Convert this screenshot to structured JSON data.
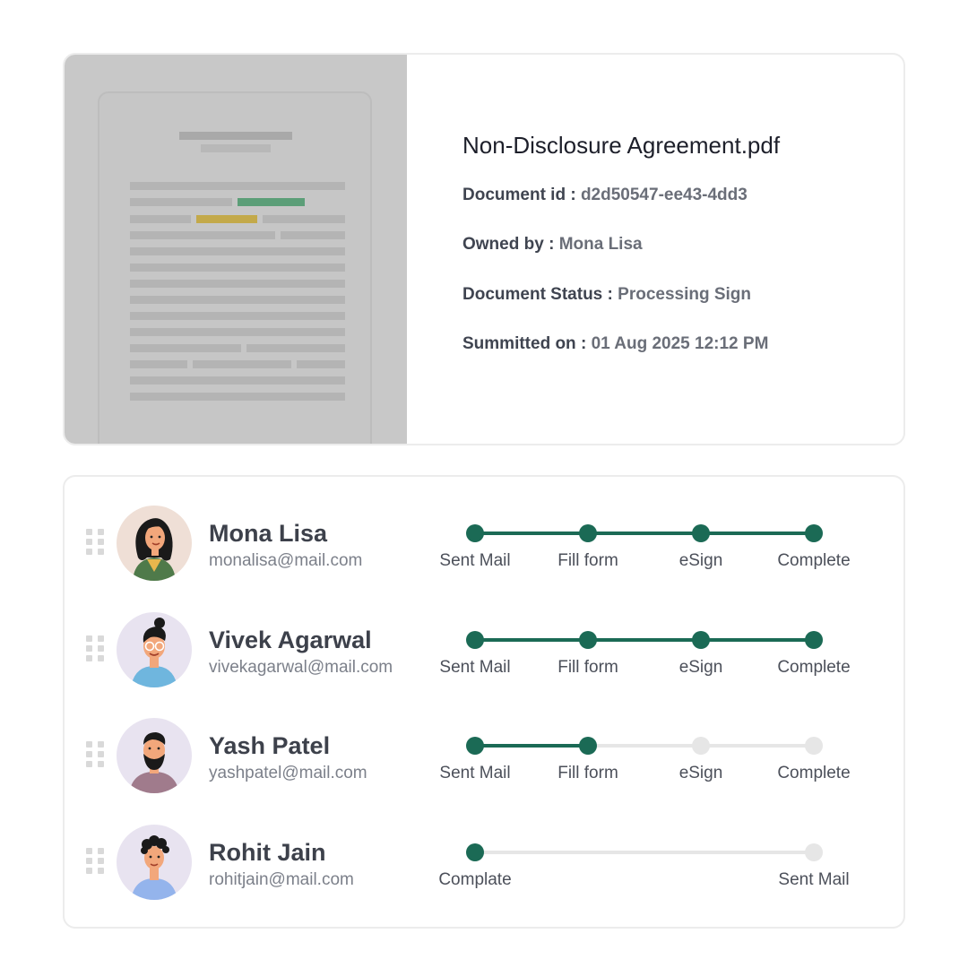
{
  "document": {
    "title": "Non-Disclosure Agreement.pdf",
    "id_label": "Document id :",
    "id_value": "d2d50547-ee43-4dd3",
    "owner_label": "Owned by :",
    "owner_value": "Mona Lisa",
    "status_label": "Document Status :",
    "status_value": "Processing Sign",
    "submitted_label": "Summitted on :",
    "submitted_value": "01 Aug 2025 12:12 PM"
  },
  "colors": {
    "accent": "#1b6a55",
    "pending": "#e6e6e6",
    "highlight_green": "#5c9e78",
    "highlight_yellow": "#c3a94a"
  },
  "signers": [
    {
      "name": "Mona Lisa",
      "email": "monalisa@mail.com",
      "avatar": "woman-avatar",
      "steps": [
        {
          "label": "Sent Mail",
          "done": true
        },
        {
          "label": "Fill form",
          "done": true
        },
        {
          "label": "eSign",
          "done": true
        },
        {
          "label": "Complete",
          "done": true
        }
      ]
    },
    {
      "name": "Vivek Agarwal",
      "email": "vivekagarwal@mail.com",
      "avatar": "man-glasses-avatar",
      "steps": [
        {
          "label": "Sent Mail",
          "done": true
        },
        {
          "label": "Fill form",
          "done": true
        },
        {
          "label": "eSign",
          "done": true
        },
        {
          "label": "Complete",
          "done": true
        }
      ]
    },
    {
      "name": "Yash Patel",
      "email": "yashpatel@mail.com",
      "avatar": "bearded-man-avatar",
      "steps": [
        {
          "label": "Sent Mail",
          "done": true
        },
        {
          "label": "Fill form",
          "done": true
        },
        {
          "label": "eSign",
          "done": false
        },
        {
          "label": "Complete",
          "done": false
        }
      ]
    },
    {
      "name": "Rohit Jain",
      "email": "rohitjain@mail.com",
      "avatar": "man-curly-avatar",
      "steps": [
        {
          "label": "Complate",
          "done": true
        },
        {
          "label": "Sent Mail",
          "done": false
        }
      ]
    }
  ]
}
